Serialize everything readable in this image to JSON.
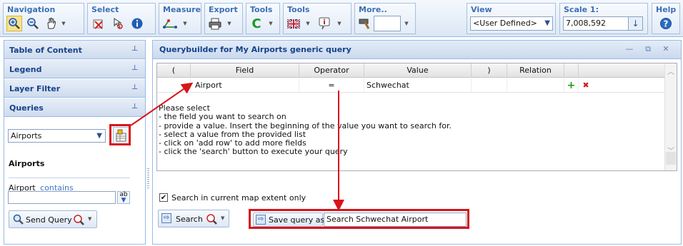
{
  "toolbar": {
    "groups": {
      "navigation": "Navigation",
      "select": "Select",
      "measure": "Measure",
      "export": "Export",
      "tools1": "Tools",
      "tools2": "Tools",
      "more": "More..",
      "view": "View",
      "scale": "Scale 1:",
      "help": "Help"
    },
    "view_select_value": "<User Defined>",
    "scale_value": "7,008,592"
  },
  "left_panel": {
    "sections": [
      "Table of Content",
      "Legend",
      "Layer Filter",
      "Queries"
    ],
    "layer_select_value": "Airports",
    "query_title": "Airports",
    "field_label": "Airport",
    "field_operator": "contains",
    "field_value": "",
    "send_query_label": "Send Query"
  },
  "querybuilder": {
    "title": "Querybuilder for My Airports generic query",
    "columns": [
      "(",
      "Field",
      "Operator",
      "Value",
      ")",
      "Relation"
    ],
    "row": {
      "open_paren": "",
      "field": "Airport",
      "operator": "=",
      "value": "Schwechat",
      "close_paren": "",
      "relation": ""
    },
    "instructions": "Please select\n- the field you want to search on\n- provide a value. Insert the beginning of the value you want to search for.\n- select a value from the provided list\n- click on 'add row' to add more fields\n- click the 'search' button to execute your query",
    "extent_checkbox_label": "Search in current map extent only",
    "extent_checked": true,
    "search_label": "Search",
    "save_label": "Save query as",
    "save_value": "Search Schwechat Airport"
  },
  "colors": {
    "accent_blue": "#15428b",
    "group_title": "#3c70b3",
    "highlight_red": "#d8141a"
  }
}
